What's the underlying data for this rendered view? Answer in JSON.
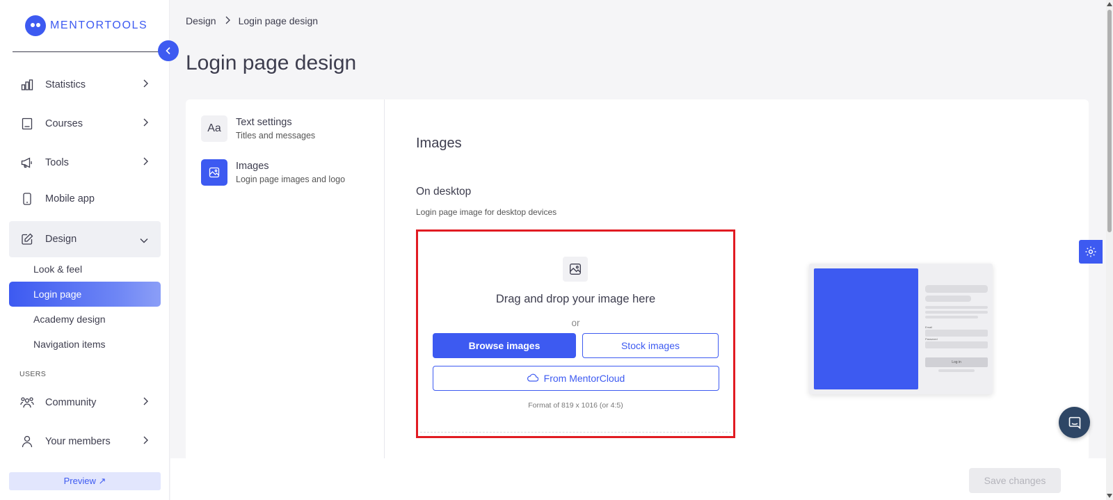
{
  "brand": {
    "name": "MENTORTOOLS"
  },
  "sidebar": {
    "items": [
      {
        "label": "Statistics",
        "icon": "bar-chart-icon"
      },
      {
        "label": "Courses",
        "icon": "book-icon"
      },
      {
        "label": "Tools",
        "icon": "megaphone-icon"
      },
      {
        "label": "Mobile app",
        "icon": "phone-icon"
      },
      {
        "label": "Design",
        "icon": "pencil-icon"
      }
    ],
    "design_subitems": [
      {
        "label": "Look & feel"
      },
      {
        "label": "Login page"
      },
      {
        "label": "Academy design"
      },
      {
        "label": "Navigation items"
      }
    ],
    "users_section_label": "USERS",
    "user_items": [
      {
        "label": "Community",
        "icon": "people-icon"
      },
      {
        "label": "Your members",
        "icon": "person-icon"
      }
    ],
    "preview_label": "Preview ↗"
  },
  "breadcrumb": {
    "parent": "Design",
    "current": "Login page design"
  },
  "page_title": "Login page design",
  "settings_menu": [
    {
      "title": "Text settings",
      "subtitle": "Titles and messages",
      "icon_text": "Aa"
    },
    {
      "title": "Images",
      "subtitle": "Login page images and logo"
    }
  ],
  "images_section": {
    "title": "Images",
    "desktop_title": "On desktop",
    "desktop_desc": "Login page image for desktop devices",
    "dropzone": {
      "title": "Drag and drop your image here",
      "or": "or",
      "browse": "Browse images",
      "stock": "Stock images",
      "cloud": "From MentorCloud",
      "format": "Format of 819 x 1016 (or 4:5)"
    },
    "preview": {
      "button": "Log in",
      "email_label": "Email",
      "password_label": "Password"
    }
  },
  "footer": {
    "save": "Save changes"
  },
  "colors": {
    "accent": "#3d5af1",
    "highlight": "#e11b22",
    "chat": "#2e4665"
  }
}
